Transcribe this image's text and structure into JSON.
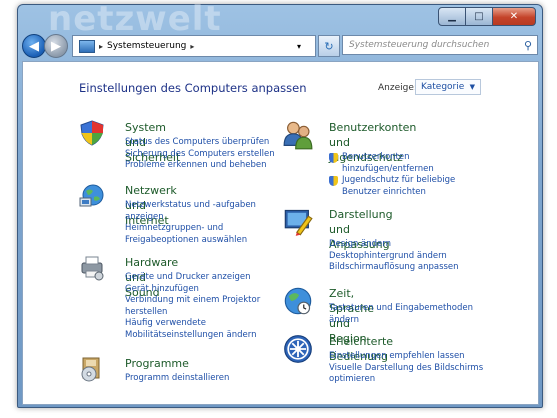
{
  "window": {
    "watermark": "netzwelt"
  },
  "caption": {
    "minimize": "▁",
    "maximize": "□",
    "close": "✕"
  },
  "nav": {
    "back_glyph": "◀",
    "forward_glyph": "▶",
    "breadcrumb_sep": "▸",
    "breadcrumb": "Systemsteuerung",
    "breadcrumb_tail": "▸",
    "dropdown": "▾",
    "refresh": "↻",
    "search_placeholder": "Systemsteuerung durchsuchen",
    "search_icon": "⚲"
  },
  "main": {
    "heading": "Einstellungen des Computers anpassen",
    "view_label": "Anzeige:",
    "view_value": "Kategorie",
    "view_arrow": "▼"
  },
  "categories": {
    "system": {
      "icon": "shield-icon",
      "title": "System und Sicherheit",
      "links": [
        "Status des Computers überprüfen",
        "Sicherung des Computers erstellen",
        "Probleme erkennen und beheben"
      ]
    },
    "network": {
      "icon": "network-icon",
      "title": "Netzwerk und Internet",
      "links": [
        "Netzwerkstatus und -aufgaben",
        "anzeigen",
        "Heimnetzgruppen- und",
        "Freigabeoptionen auswählen"
      ]
    },
    "hardware": {
      "icon": "printer-icon",
      "title": "Hardware und Sound",
      "links": [
        "Geräte und Drucker anzeigen",
        "Gerät hinzufügen",
        "Verbindung mit einem Projektor",
        "herstellen",
        "Häufig verwendete",
        "Mobilitätseinstellungen ändern"
      ]
    },
    "programs": {
      "icon": "programs-icon",
      "title": "Programme",
      "links": [
        "Programm deinstallieren"
      ]
    },
    "users": {
      "icon": "users-icon",
      "title_line1": "Benutzerkonten und",
      "title_line2": "Jugendschutz",
      "links": [
        "Benutzerkonten",
        "hinzufügen/entfernen",
        "Jugendschutz für beliebige",
        "Benutzer einrichten"
      ]
    },
    "appearance": {
      "icon": "appearance-icon",
      "title_line1": "Darstellung und",
      "title_line2": "Anpassung",
      "links": [
        "Design ändern",
        "Desktophintergrund ändern",
        "Bildschirmauflösung anpassen"
      ]
    },
    "clock": {
      "icon": "globe-clock-icon",
      "title": "Zeit, Sprache und Region",
      "links": [
        "Tastaturen und Eingabemethoden",
        "ändern"
      ]
    },
    "access": {
      "icon": "accessibility-icon",
      "title": "Erleichterte Bedienung",
      "links": [
        "Einstellungen empfehlen lassen",
        "Visuelle Darstellung des Bildschirms",
        "optimieren"
      ]
    }
  },
  "colors": {
    "link": "#1f4fa7",
    "category_title": "#1d5a2a",
    "heading": "#1e3287",
    "close": "#c4432a"
  }
}
